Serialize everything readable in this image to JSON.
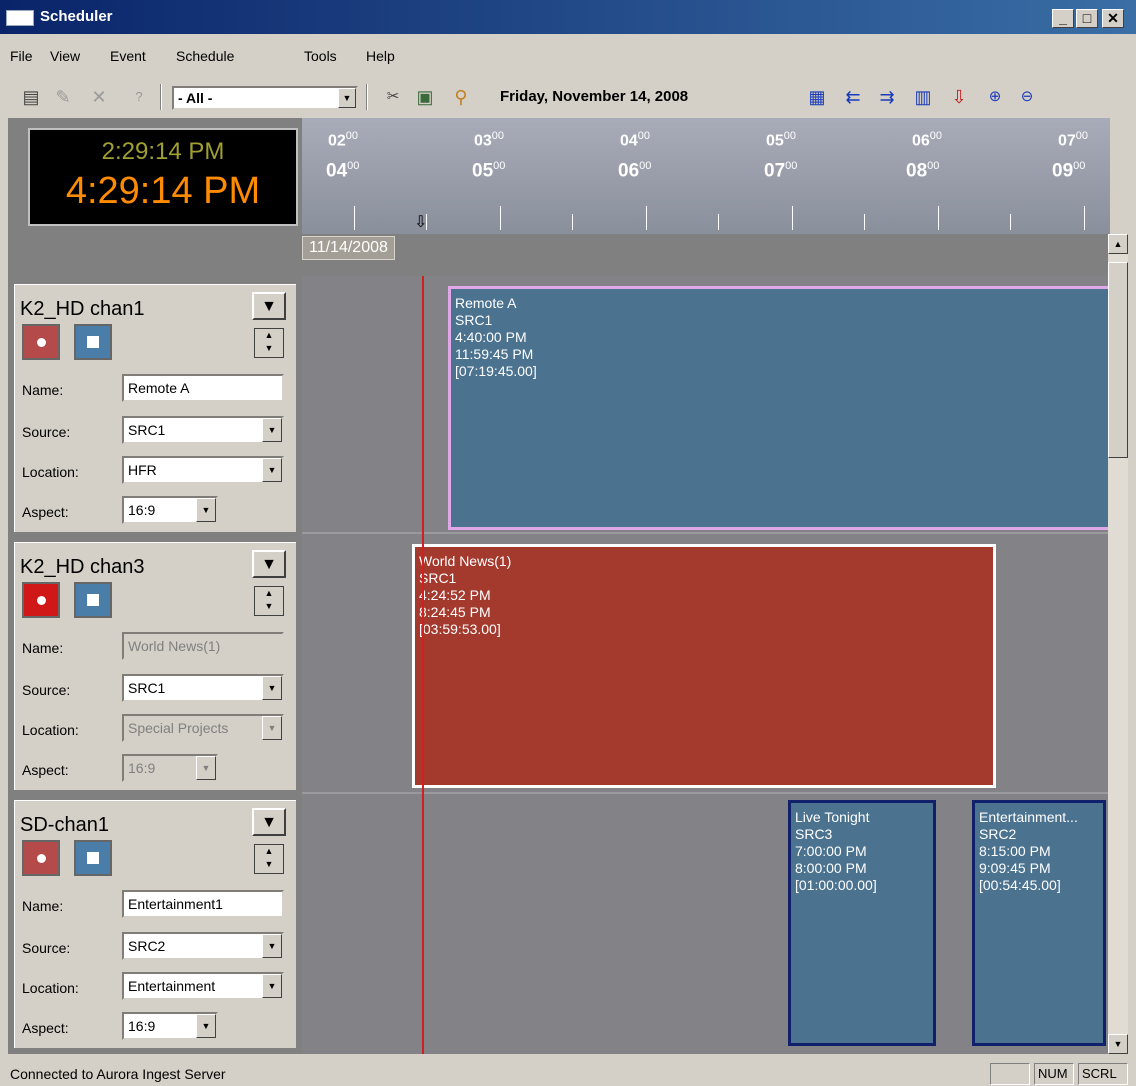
{
  "window": {
    "title": "Scheduler",
    "buttons": {
      "minimize": "_",
      "maximize": "□",
      "close": "✕"
    }
  },
  "menu": [
    "File",
    "View",
    "Event",
    "Schedule",
    "Tools",
    "Help"
  ],
  "toolbar": {
    "filter": "- All -",
    "date": "Friday, November 14, 2008",
    "icons": [
      "clipboard-icon",
      "edit-icon",
      "delete-icon",
      "help-icon",
      "scissors-icon",
      "monitor-icon",
      "search-icon",
      "grid-icon",
      "arrow-left-icon",
      "arrow-right-icon",
      "calendar-icon",
      "alarm-icon",
      "zoom-in-icon",
      "zoom-out-icon"
    ]
  },
  "clock": {
    "time_a": "2:29:14 PM",
    "time_b": "4:29:14 PM"
  },
  "timeline": {
    "top_hours": [
      "02",
      "03",
      "04",
      "05",
      "06",
      "07"
    ],
    "bottom_hours": [
      "04",
      "05",
      "06",
      "07",
      "08",
      "09"
    ],
    "minutes": "00",
    "date_tag": "11/14/2008"
  },
  "labels": {
    "name": "Name:",
    "source": "Source:",
    "location": "Location:",
    "aspect": "Aspect:"
  },
  "channels": [
    {
      "name": "K2_HD chan1",
      "name_value": "Remote A",
      "source": "SRC1",
      "location": "HFR",
      "aspect": "16:9"
    },
    {
      "name": "K2_HD chan3",
      "name_value": "World News(1)",
      "source": "SRC1",
      "location": "Special Projects",
      "aspect": "16:9"
    },
    {
      "name": "SD-chan1",
      "name_value": "Entertainment1",
      "source": "SRC2",
      "location": "Entertainment",
      "aspect": "16:9"
    }
  ],
  "events": [
    {
      "title": "Remote A",
      "source": "SRC1",
      "start": "4:40:00 PM",
      "end": "11:59:45 PM",
      "duration": "[07:19:45.00]"
    },
    {
      "title": "World News(1)",
      "source": "SRC1",
      "start": "4:24:52 PM",
      "end": "8:24:45 PM",
      "duration": "[03:59:53.00]"
    },
    {
      "title": "Live Tonight",
      "source": "SRC3",
      "start": "7:00:00 PM",
      "end": "8:00:00 PM",
      "duration": "[01:00:00.00]"
    },
    {
      "title": "Entertainment...",
      "source": "SRC2",
      "start": "8:15:00 PM",
      "end": "9:09:45 PM",
      "duration": "[00:54:45.00]"
    }
  ],
  "status": {
    "text": "Connected to Aurora Ingest Server",
    "num": "NUM",
    "scrl": "SCRL"
  },
  "colors": {
    "titlebar": "#0a246a",
    "event_blue": "#4b728f",
    "event_red": "#a43a2e",
    "now_line": "#d02020",
    "clock_amber": "#ff8c00"
  }
}
